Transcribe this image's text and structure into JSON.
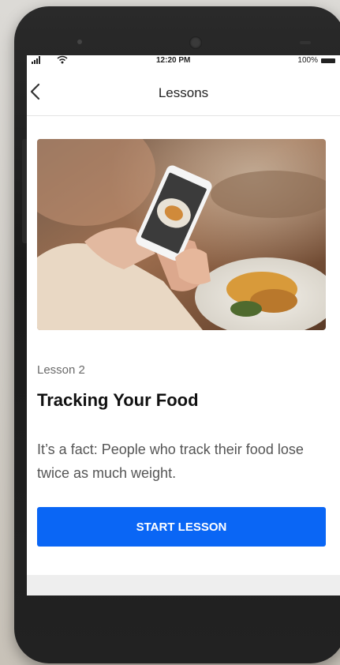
{
  "status_bar": {
    "time": "12:20 PM",
    "battery": "100%",
    "icons": [
      "signal-icon",
      "wifi-icon",
      "battery-icon"
    ]
  },
  "header": {
    "title": "Lessons",
    "back_icon": "chevron-left-icon"
  },
  "lesson": {
    "number_label": "Lesson 2",
    "title": "Tracking Your Food",
    "description": "It’s a fact: People who track their food lose twice as much weight.",
    "button_label": "START LESSON"
  },
  "colors": {
    "accent": "#0a66f5",
    "text_primary": "#111111",
    "text_secondary": "#555555"
  }
}
